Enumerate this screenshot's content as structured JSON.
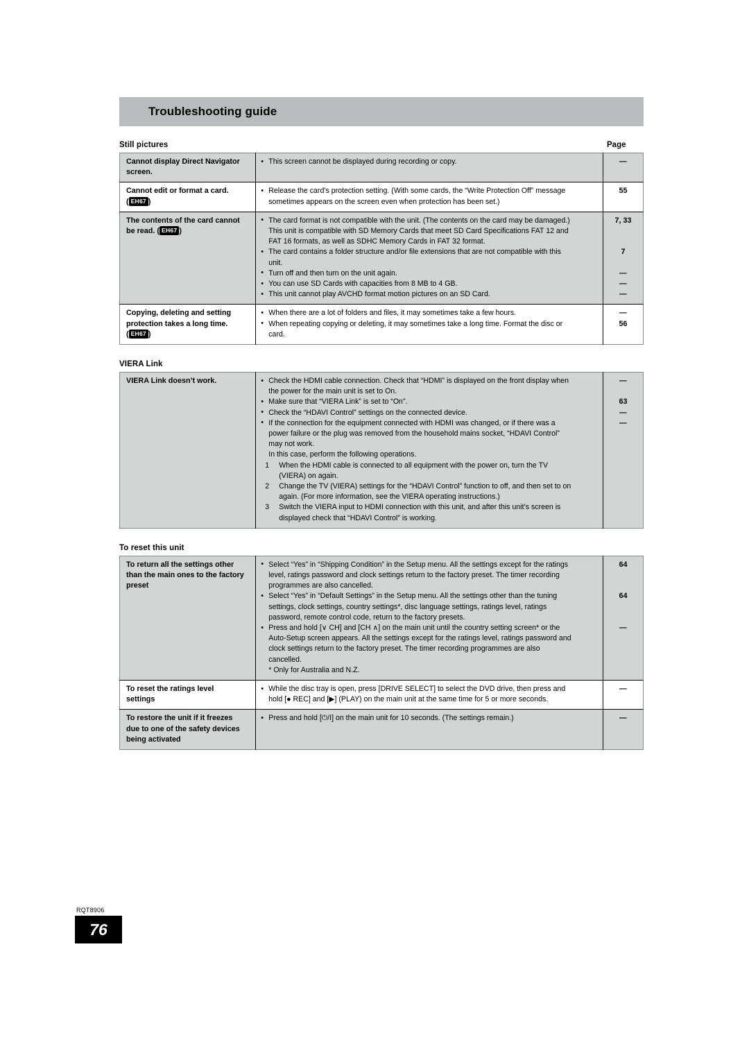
{
  "header": {
    "title": "Troubleshooting guide"
  },
  "page_column_label": "Page",
  "sections": [
    {
      "caption": "Still pictures",
      "rows": [
        {
          "symptom_lines": [
            "Cannot display Direct Navigator",
            "screen."
          ],
          "shaded": true,
          "body_lines": [
            {
              "kind": "bullet",
              "text": "This screen cannot be displayed during recording or copy."
            }
          ],
          "pages": [
            "—"
          ]
        },
        {
          "symptom_lines": [
            "Cannot edit or format a card.",
            "(EH67)"
          ],
          "shaded": false,
          "body_lines": [
            {
              "kind": "bullet",
              "text": "Release the card’s protection setting. (With some cards, the “Write Protection Off” message"
            },
            {
              "kind": "cont",
              "text": "sometimes appears on the screen even when protection has been set.)"
            }
          ],
          "pages": [
            "55"
          ]
        },
        {
          "symptom_lines": [
            "The contents of the card cannot",
            "be read. (EH67)"
          ],
          "shaded": true,
          "body_lines": [
            {
              "kind": "bullet",
              "text": "The card format is not compatible with the unit. (The contents on the card may be damaged.)"
            },
            {
              "kind": "cont",
              "text": "This unit is compatible with SD Memory Cards that meet SD Card Specifications FAT 12 and"
            },
            {
              "kind": "cont",
              "text": "FAT 16 formats, as well as SDHC Memory Cards in FAT 32 format."
            },
            {
              "kind": "bullet",
              "text": "The card contains a folder structure and/or file extensions that are not compatible with this"
            },
            {
              "kind": "cont",
              "text": "unit."
            },
            {
              "kind": "bullet",
              "text": "Turn off and then turn on the unit again."
            },
            {
              "kind": "bullet",
              "text": "You can use SD Cards with capacities from 8 MB to 4 GB."
            },
            {
              "kind": "bullet",
              "text": "This unit cannot play AVCHD format motion pictures on an SD Card."
            }
          ],
          "pages": [
            "7, 33",
            "",
            "",
            "7",
            "",
            "—",
            "—",
            "—"
          ]
        },
        {
          "symptom_lines": [
            "Copying, deleting and setting",
            "protection takes a long time.",
            "(EH67)"
          ],
          "shaded": false,
          "body_lines": [
            {
              "kind": "bullet",
              "text": "When there are a lot of folders and files, it may sometimes take a few hours."
            },
            {
              "kind": "bullet",
              "text": "When repeating copying or deleting, it may sometimes take a long time. Format the disc or"
            },
            {
              "kind": "cont",
              "text": "card."
            }
          ],
          "pages": [
            "—",
            "56",
            ""
          ]
        }
      ]
    },
    {
      "caption": "VIERA Link",
      "rows": [
        {
          "symptom_lines": [
            "VIERA Link doesn’t work."
          ],
          "shaded": true,
          "body_lines": [
            {
              "kind": "bullet",
              "text": "Check the HDMI cable connection. Check that “HDMI” is displayed on the front display when"
            },
            {
              "kind": "cont",
              "text": "the power for the main unit is set to On."
            },
            {
              "kind": "bullet",
              "text": "Make sure that “VIERA Link” is set to “On”."
            },
            {
              "kind": "bullet",
              "text": "Check the “HDAVI Control” settings on the connected device."
            },
            {
              "kind": "bullet",
              "text": "If the connection for the equipment connected with HDMI was changed, or if there was a"
            },
            {
              "kind": "cont",
              "text": "power failure or the plug was removed from the household mains socket, “HDAVI Control”"
            },
            {
              "kind": "cont",
              "text": "may not work."
            },
            {
              "kind": "plain",
              "text": "In this case, perform the following operations."
            },
            {
              "kind": "num",
              "num": "1",
              "text": "When the HDMI cable is connected to all equipment with the power on, turn the TV"
            },
            {
              "kind": "numcont",
              "text": "(VIERA) on again."
            },
            {
              "kind": "num",
              "num": "2",
              "text": "Change the TV (VIERA) settings for the “HDAVI Control” function to off, and then set to on"
            },
            {
              "kind": "numcont",
              "text": "again. (For more information, see the VIERA operating instructions.)"
            },
            {
              "kind": "num",
              "num": "3",
              "text": "Switch the VIERA input to HDMI connection with this unit, and after this unit’s screen is"
            },
            {
              "kind": "numcont",
              "text": "displayed check that “HDAVI Control” is working."
            }
          ],
          "pages": [
            "—",
            "",
            "63",
            "—",
            "—",
            "",
            "",
            "",
            "",
            "",
            "",
            "",
            "",
            ""
          ]
        }
      ]
    },
    {
      "caption": "To reset this unit",
      "rows": [
        {
          "symptom_lines": [
            "To return all the settings other",
            "than the main ones to the factory",
            "preset"
          ],
          "shaded": true,
          "body_lines": [
            {
              "kind": "bullet",
              "text": "Select “Yes” in “Shipping Condition” in the Setup menu. All the settings except for the ratings"
            },
            {
              "kind": "cont",
              "text": "level, ratings password and clock settings return to the factory preset. The timer recording"
            },
            {
              "kind": "cont",
              "text": "programmes are also cancelled."
            },
            {
              "kind": "bullet",
              "text": "Select “Yes” in “Default Settings” in the Setup menu. All the settings other than the tuning"
            },
            {
              "kind": "cont",
              "text": "settings, clock settings, country settings*, disc language settings, ratings level, ratings"
            },
            {
              "kind": "cont",
              "text": "password, remote control code, return to the factory presets."
            },
            {
              "kind": "bullet",
              "text": "Press and hold [∨ CH] and [CH ∧] on the main unit until the country setting screen* or the"
            },
            {
              "kind": "cont",
              "text": "Auto-Setup screen appears. All the settings except for the ratings level, ratings password and"
            },
            {
              "kind": "cont",
              "text": "clock settings return to the factory preset. The timer recording programmes are also"
            },
            {
              "kind": "cont",
              "text": "cancelled."
            },
            {
              "kind": "note",
              "text": "* Only for Australia and N.Z."
            }
          ],
          "pages": [
            "64",
            "",
            "",
            "64",
            "",
            "",
            "—",
            "",
            "",
            "",
            ""
          ]
        },
        {
          "symptom_lines": [
            "To reset the ratings level",
            "settings"
          ],
          "shaded": false,
          "body_lines": [
            {
              "kind": "bullet",
              "text": "While the disc tray is open, press [DRIVE SELECT] to select the DVD drive, then press and"
            },
            {
              "kind": "cont",
              "text": "hold [● REC] and [▶] (PLAY) on the main unit at the same time for 5 or more seconds."
            }
          ],
          "pages": [
            "—",
            ""
          ]
        },
        {
          "symptom_lines": [
            "To restore the unit if it freezes",
            "due to one of the safety devices",
            "being activated"
          ],
          "shaded": true,
          "body_lines": [
            {
              "kind": "bullet",
              "text": "Press and hold [⏻/I] on the main unit for 10 seconds. (The settings remain.)"
            }
          ],
          "pages": [
            "—"
          ]
        }
      ]
    }
  ],
  "footer": {
    "doc_code": "RQT8906",
    "page_number": "76"
  }
}
